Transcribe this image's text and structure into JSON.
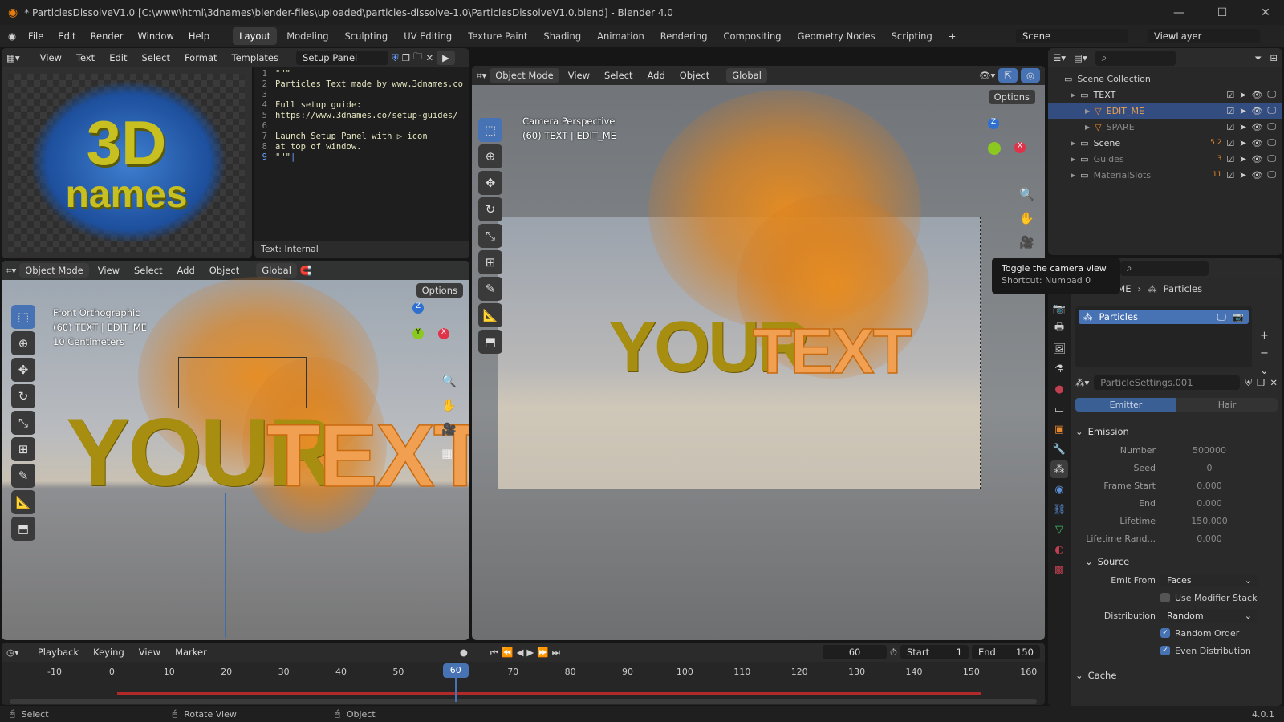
{
  "window": {
    "title": "* ParticlesDissolveV1.0 [C:\\www\\html\\3dnames\\blender-files\\uploaded\\particles-dissolve-1.0\\ParticlesDissolveV1.0.blend] - Blender 4.0",
    "minimize": "—",
    "maximize": "☐",
    "close": "✕"
  },
  "menus": [
    "File",
    "Edit",
    "Render",
    "Window",
    "Help"
  ],
  "workspaces": [
    "Layout",
    "Modeling",
    "Sculpting",
    "UV Editing",
    "Texture Paint",
    "Shading",
    "Animation",
    "Rendering",
    "Compositing",
    "Geometry Nodes",
    "Scripting",
    "+"
  ],
  "scene": "Scene",
  "view_layer": "ViewLayer",
  "text_editor": {
    "menus": [
      "View",
      "Text",
      "Edit",
      "Select",
      "Format",
      "Templates"
    ],
    "file": "Setup Panel",
    "footer": "Text: Internal",
    "lines": [
      "\"\"\"",
      "Particles Text made by www.3dnames.co",
      "",
      "Full setup guide:",
      "https://www.3dnames.co/setup-guides/",
      "",
      "Launch Setup Panel with ▷ icon",
      "at top of window.",
      "\"\"\""
    ]
  },
  "image_editor": {
    "logo_line1": "3D",
    "logo_line2": "names"
  },
  "viewport_left": {
    "mode": "Object Mode",
    "menus": [
      "View",
      "Select",
      "Add",
      "Object"
    ],
    "orientation": "Global",
    "options": "Options",
    "overlay": [
      "Front Orthographic",
      "(60) TEXT | EDIT_ME",
      "10 Centimeters"
    ],
    "text": "YOUR",
    "ghost": "TEXT"
  },
  "viewport_cam": {
    "mode": "Object Mode",
    "menus": [
      "View",
      "Select",
      "Add",
      "Object"
    ],
    "orientation": "Global",
    "options": "Options",
    "overlay": [
      "Camera Perspective",
      "(60) TEXT | EDIT_ME"
    ],
    "text": "YOUR",
    "ghost": "TEXT",
    "tooltip": {
      "title": "Toggle the camera view",
      "shortcut": "Shortcut: Numpad 0"
    },
    "axes": {
      "z": "Z",
      "y": "Y",
      "x": "X"
    }
  },
  "outliner": {
    "root": "Scene Collection",
    "items": [
      {
        "label": "TEXT",
        "indent": 1,
        "active": false,
        "dim": false
      },
      {
        "label": "EDIT_ME",
        "indent": 2,
        "active": true,
        "dim": false
      },
      {
        "label": "SPARE",
        "indent": 2,
        "active": false,
        "dim": true
      },
      {
        "label": "Scene",
        "indent": 1,
        "active": false,
        "dim": false,
        "badges": "5 2"
      },
      {
        "label": "Guides",
        "indent": 1,
        "active": false,
        "dim": true,
        "badges": "3"
      },
      {
        "label": "MaterialSlots",
        "indent": 1,
        "active": false,
        "dim": true,
        "badges": "11"
      }
    ]
  },
  "properties": {
    "breadcrumb_obj": "EDIT_ME",
    "breadcrumb_tab": "Particles",
    "system": "Particles",
    "settings": "ParticleSettings.001",
    "type_tabs": [
      "Emitter",
      "Hair"
    ],
    "emission": {
      "title": "Emission",
      "fields": [
        {
          "label": "Number",
          "value": "500000"
        },
        {
          "label": "Seed",
          "value": "0"
        },
        {
          "label": "Frame Start",
          "value": "0.000"
        },
        {
          "label": "End",
          "value": "0.000"
        },
        {
          "label": "Lifetime",
          "value": "150.000"
        },
        {
          "label": "Lifetime Rand...",
          "value": "0.000"
        }
      ]
    },
    "source": {
      "title": "Source",
      "emit_from_label": "Emit From",
      "emit_from": "Faces",
      "use_modifier_stack": "Use Modifier Stack",
      "distribution_label": "Distribution",
      "distribution": "Random",
      "random_order": "Random Order",
      "even_distribution": "Even Distribution"
    },
    "cache": "Cache"
  },
  "timeline": {
    "menus": [
      "Playback",
      "Keying",
      "View",
      "Marker"
    ],
    "current_frame": "60",
    "start_label": "Start",
    "start": "1",
    "end_label": "End",
    "end": "150",
    "ticks": [
      "-10",
      "0",
      "10",
      "20",
      "30",
      "40",
      "50",
      "60",
      "70",
      "80",
      "90",
      "100",
      "110",
      "120",
      "130",
      "140",
      "150",
      "160"
    ]
  },
  "status": {
    "select": "Select",
    "rotate": "Rotate View",
    "object": "Object",
    "version": "4.0.1"
  }
}
